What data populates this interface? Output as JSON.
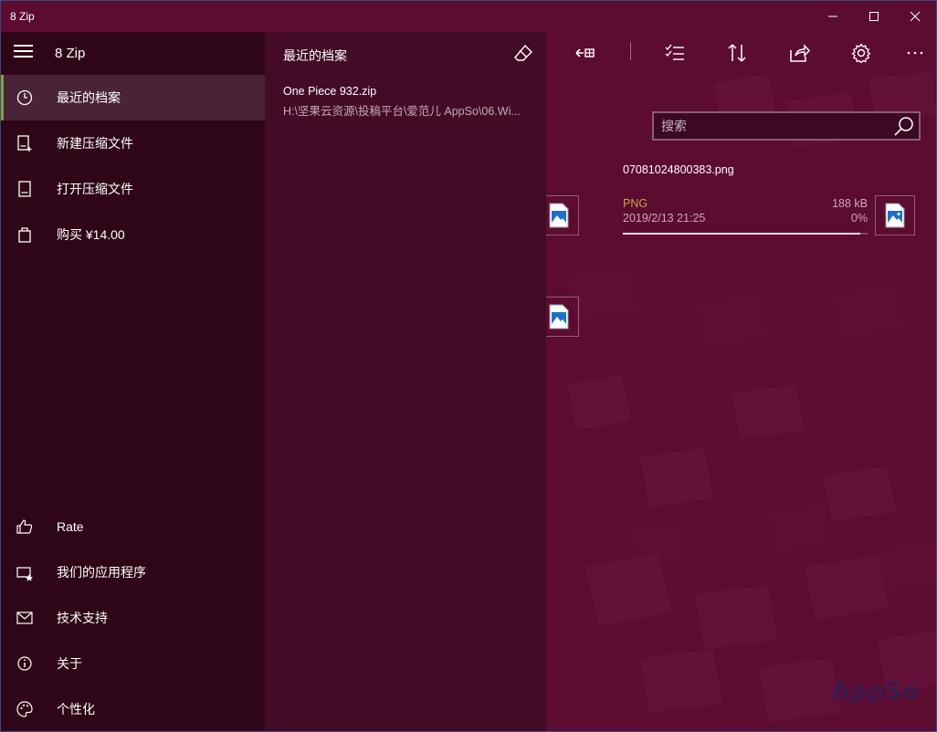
{
  "window": {
    "title": "8 Zip",
    "controls": {
      "minimize": "minimize",
      "maximize": "maximize",
      "close": "close"
    }
  },
  "nav": {
    "title": "8 Zip",
    "items": [
      {
        "label": "最近的档案",
        "icon": "clock-icon",
        "active": true
      },
      {
        "label": "新建压缩文件",
        "icon": "new-archive-icon",
        "active": false
      },
      {
        "label": "打开压缩文件",
        "icon": "open-archive-icon",
        "active": false
      },
      {
        "label": "购买 ¥14.00",
        "icon": "shopping-bag-icon",
        "active": false
      }
    ],
    "bottom_items": [
      {
        "label": "Rate",
        "icon": "thumbs-up-icon"
      },
      {
        "label": "我们的应用程序",
        "icon": "apps-icon"
      },
      {
        "label": "技术支持",
        "icon": "mail-icon"
      },
      {
        "label": "关于",
        "icon": "info-icon"
      },
      {
        "label": "个性化",
        "icon": "palette-icon"
      }
    ]
  },
  "flyout": {
    "title": "最近的档案",
    "recent": [
      {
        "name": "One Piece 932.zip",
        "path": "H:\\坚果云资源\\投稿平台\\爱范儿 AppSo\\06.Wi..."
      }
    ]
  },
  "toolbar": {
    "buttons": [
      "extract-icon",
      "select-icon",
      "sort-icon",
      "share-icon",
      "gear-icon",
      "more-icon"
    ]
  },
  "search": {
    "placeholder": "搜索"
  },
  "file": {
    "name": "07081024800383.png",
    "type": "PNG",
    "date": "2019/2/13 21:25",
    "size": "188 kB",
    "percent": "0%",
    "progress_fraction": 0.97
  },
  "watermark": "AppSo",
  "colors": {
    "accent": "#5c0b31",
    "nav_bg": "#2e0618",
    "flyout_bg": "#430b26",
    "type_label": "#c9a640",
    "active_indicator": "#8a9c3e"
  }
}
